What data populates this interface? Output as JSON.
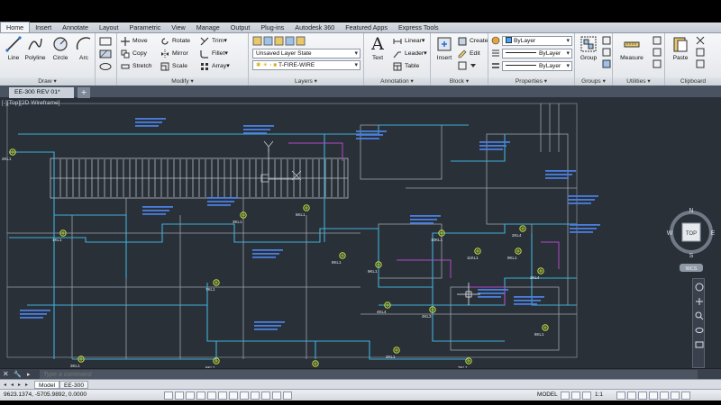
{
  "ribbon_tabs": [
    "Home",
    "Insert",
    "Annotate",
    "Layout",
    "Parametric",
    "View",
    "Manage",
    "Output",
    "Plug-ins",
    "Autodesk 360",
    "Featured Apps",
    "Express Tools"
  ],
  "active_tab": "Home",
  "panels": {
    "draw": {
      "title": "Draw",
      "tools": [
        "Line",
        "Polyline",
        "Circle",
        "Arc"
      ]
    },
    "modify": {
      "title": "Modify",
      "rows": [
        [
          "Move",
          "Rotate",
          "Trim"
        ],
        [
          "Copy",
          "Mirror",
          "Fillet"
        ],
        [
          "Stretch",
          "Scale",
          "Array"
        ]
      ]
    },
    "layers": {
      "title": "Layers",
      "layer_state": "Unsaved Layer State",
      "current_layer": "T-FIRE-WIRE"
    },
    "annotation": {
      "title": "Annotation",
      "big_tool": "Text",
      "tools": [
        "Linear",
        "Leader",
        "Table"
      ]
    },
    "block": {
      "title": "Block",
      "big_tool": "Insert",
      "tools": [
        "Create",
        "Edit"
      ]
    },
    "properties": {
      "title": "Properties",
      "color": "ByLayer",
      "linetype": "ByLayer",
      "lineweight": "ByLayer"
    },
    "groups": {
      "title": "Groups",
      "big_tool": "Group"
    },
    "utilities": {
      "title": "Utilities",
      "big_tool": "Measure"
    },
    "clipboard": {
      "title": "Clipboard",
      "big_tool": "Paste"
    }
  },
  "document_tab": "EE-300 REV 01*",
  "viewport_label": "[-][Top][2D Wireframe]",
  "viewcube": {
    "top": "TOP",
    "north": "N",
    "south": "S",
    "east": "E",
    "west": "W",
    "wcs": "WCS"
  },
  "command_placeholder": "Type a command",
  "layout_tabs": [
    "Model",
    "EE-300"
  ],
  "active_layout": "Model",
  "status": {
    "coords": "9623.1374, -5705.9892, 0.0000",
    "model": "MODEL",
    "scale": "1:1"
  },
  "colors": {
    "background": "#2a3038",
    "wire": "#3fb0d8",
    "arch": "#b9bec6",
    "annotation": "#4a7fe0",
    "device": "#c8e23a",
    "magenta": "#b04ac8"
  },
  "drawing": {
    "labels": [
      "2KL1",
      "1KL1",
      "3KL1",
      "6KL1",
      "7KL1",
      "8KL1",
      "9KL1",
      "10KL1",
      "11KL1",
      "2KL4",
      "3KL4",
      "4KL4",
      "4KL3"
    ]
  }
}
